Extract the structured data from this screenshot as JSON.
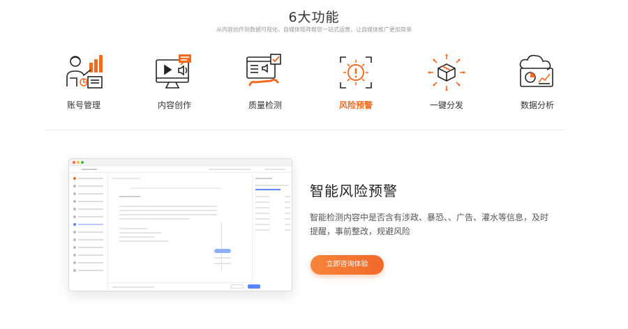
{
  "header": {
    "title": "6大功能",
    "subtitle": "从内容创作到数据可视化，自媒体矩阵帮您一站式运营，让自媒体推广更加简单"
  },
  "features": [
    {
      "label": "账号管理",
      "icon": "account-manager-icon",
      "active": false
    },
    {
      "label": "内容创作",
      "icon": "content-monitor-icon",
      "active": false
    },
    {
      "label": "质量检测",
      "icon": "quality-check-icon",
      "active": false
    },
    {
      "label": "风险预警",
      "icon": "risk-warning-icon",
      "active": true
    },
    {
      "label": "一键分发",
      "icon": "distribution-box-icon",
      "active": false
    },
    {
      "label": "数据分析",
      "icon": "data-analysis-icon",
      "active": false
    }
  ],
  "highlight": {
    "title": "智能风险预警",
    "description": "智能检测内容中是否含有涉政、暴恐、、广告、灌水等信息，及时提醒，事前整改，规避风险",
    "cta_label": "立即咨询体验"
  },
  "colors": {
    "accent": "#f26b21",
    "text": "#333333",
    "muted": "#999999"
  }
}
